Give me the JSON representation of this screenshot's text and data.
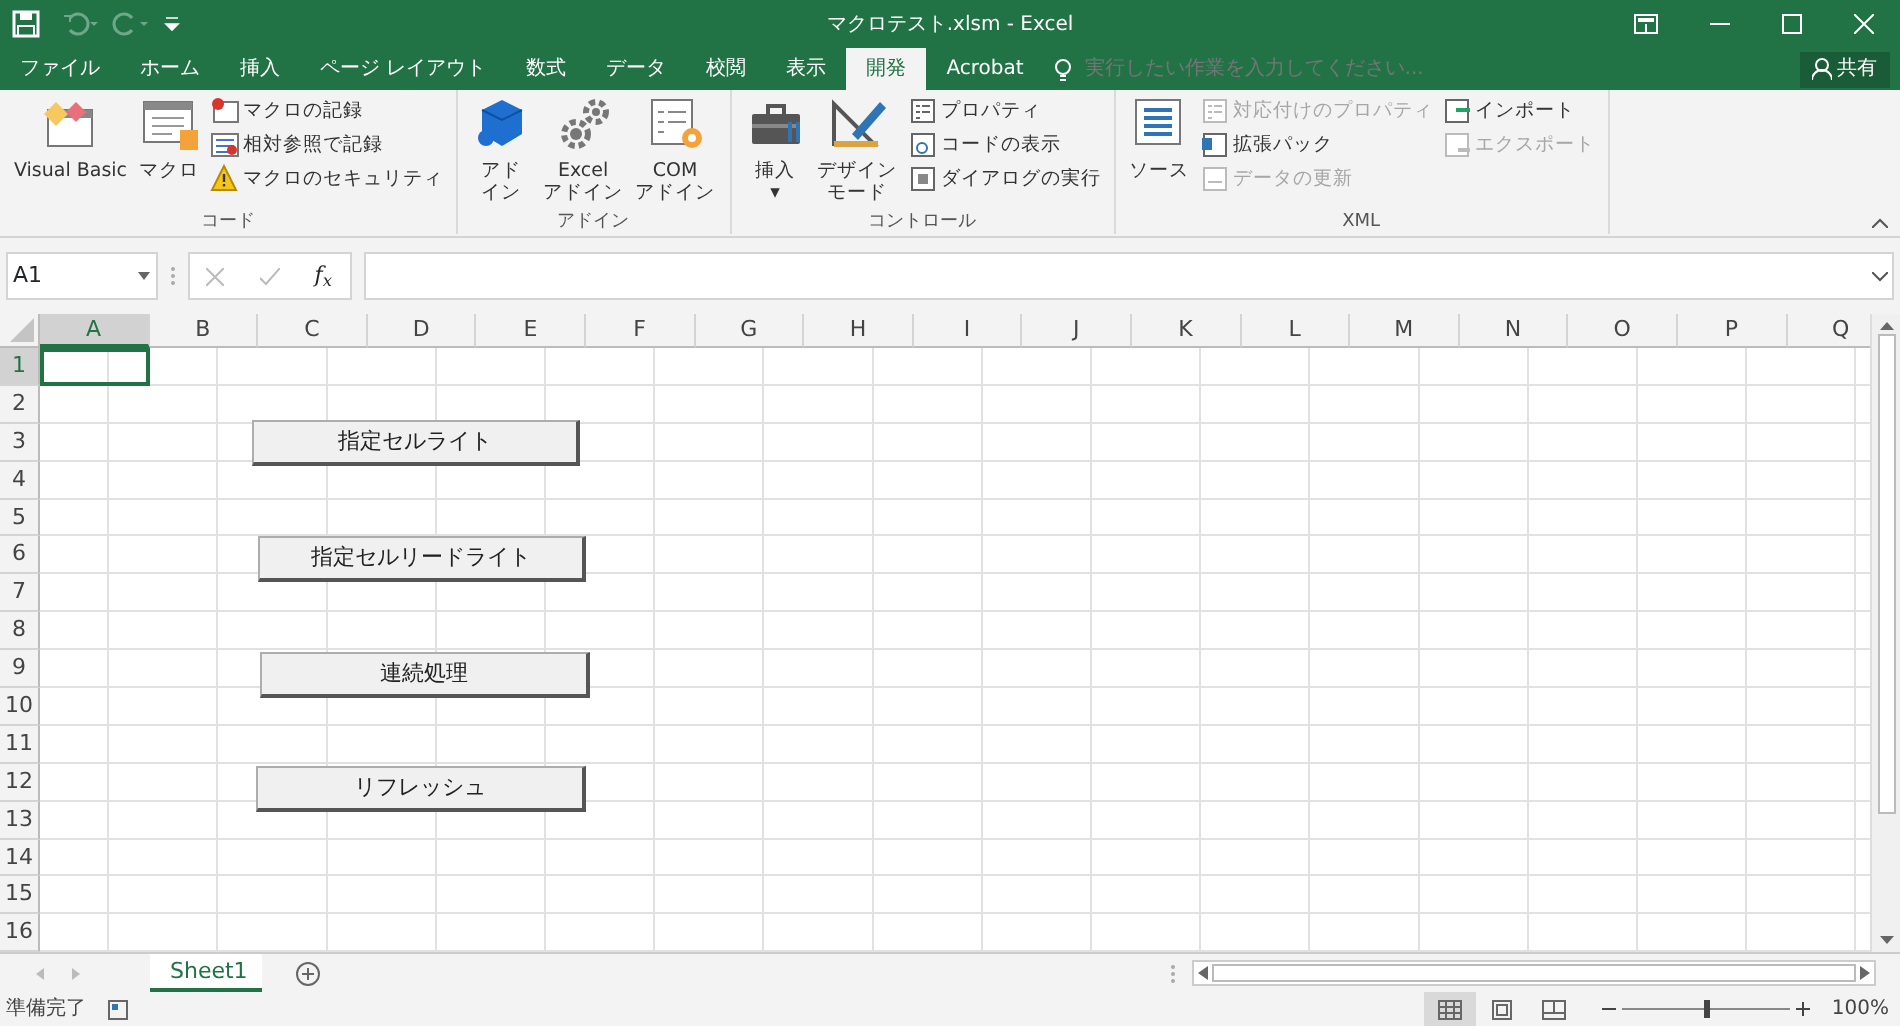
{
  "window": {
    "title": "マクロテスト.xlsm - Excel"
  },
  "ribbon_tabs": [
    {
      "label": "ファイル",
      "selected": false
    },
    {
      "label": "ホーム",
      "selected": false
    },
    {
      "label": "挿入",
      "selected": false
    },
    {
      "label": "ページ レイアウト",
      "selected": false
    },
    {
      "label": "数式",
      "selected": false
    },
    {
      "label": "データ",
      "selected": false
    },
    {
      "label": "校閲",
      "selected": false
    },
    {
      "label": "表示",
      "selected": false
    },
    {
      "label": "開発",
      "selected": true
    },
    {
      "label": "Acrobat",
      "selected": false
    }
  ],
  "tell_me": {
    "placeholder": "実行したい作業を入力してください..."
  },
  "share": "共有",
  "ribbon_groups": [
    {
      "label": "コード",
      "items": [
        {
          "kind": "large",
          "lines": [
            "Visual Basic"
          ],
          "disabled": false
        },
        {
          "kind": "large",
          "lines": [
            "マクロ"
          ],
          "disabled": false
        },
        {
          "kind": "small",
          "lines": [
            "マクロの記録"
          ],
          "disabled": false
        },
        {
          "kind": "small",
          "lines": [
            "相対参照で記録"
          ],
          "disabled": false
        },
        {
          "kind": "small",
          "lines": [
            "マクロのセキュリティ"
          ],
          "disabled": false
        }
      ]
    },
    {
      "label": "アドイン",
      "items": [
        {
          "kind": "large",
          "lines": [
            "アド",
            "イン"
          ],
          "disabled": false
        },
        {
          "kind": "large",
          "lines": [
            "Excel",
            "アドイン"
          ],
          "disabled": false
        },
        {
          "kind": "large",
          "lines": [
            "COM",
            "アドイン"
          ],
          "disabled": false
        }
      ]
    },
    {
      "label": "コントロール",
      "items": [
        {
          "kind": "large",
          "lines": [
            "挿入",
            "▾"
          ],
          "disabled": false
        },
        {
          "kind": "large",
          "lines": [
            "デザイン",
            "モード"
          ],
          "disabled": false
        },
        {
          "kind": "small",
          "lines": [
            "プロパティ"
          ],
          "disabled": false
        },
        {
          "kind": "small",
          "lines": [
            "コードの表示"
          ],
          "disabled": false
        },
        {
          "kind": "small",
          "lines": [
            "ダイアログの実行"
          ],
          "disabled": false
        }
      ]
    },
    {
      "label": "XML",
      "items": [
        {
          "kind": "large",
          "lines": [
            "ソース"
          ],
          "disabled": false
        },
        {
          "kind": "small",
          "lines": [
            "対応付けのプロパティ"
          ],
          "disabled": true
        },
        {
          "kind": "small",
          "lines": [
            "拡張パック"
          ],
          "disabled": false
        },
        {
          "kind": "small",
          "lines": [
            "データの更新"
          ],
          "disabled": true
        },
        {
          "kind": "small",
          "lines": [
            "インポート"
          ],
          "disabled": false
        },
        {
          "kind": "small",
          "lines": [
            "エクスポート"
          ],
          "disabled": true
        }
      ]
    }
  ],
  "name_box": "A1",
  "function_label": "f$_{x}$",
  "columns": [
    {
      "label": "A",
      "selected": true
    },
    {
      "label": "B",
      "selected": false
    },
    {
      "label": "C",
      "selected": false
    },
    {
      "label": "D",
      "selected": false
    },
    {
      "label": "E",
      "selected": false
    },
    {
      "label": "F",
      "selected": false
    },
    {
      "label": "G",
      "selected": false
    },
    {
      "label": "H",
      "selected": false
    },
    {
      "label": "I",
      "selected": false
    },
    {
      "label": "J",
      "selected": false
    },
    {
      "label": "K",
      "selected": false
    },
    {
      "label": "L",
      "selected": false
    },
    {
      "label": "M",
      "selected": false
    },
    {
      "label": "N",
      "selected": false
    },
    {
      "label": "O",
      "selected": false
    },
    {
      "label": "P",
      "selected": false
    },
    {
      "label": "Q",
      "selected": false
    }
  ],
  "rows": [
    {
      "label": "1",
      "selected": true
    },
    {
      "label": "2",
      "selected": false
    },
    {
      "label": "3",
      "selected": false
    },
    {
      "label": "4",
      "selected": false
    },
    {
      "label": "5",
      "selected": false
    },
    {
      "label": "6",
      "selected": false
    },
    {
      "label": "7",
      "selected": false
    },
    {
      "label": "8",
      "selected": false
    },
    {
      "label": "9",
      "selected": false
    },
    {
      "label": "10",
      "selected": false
    },
    {
      "label": "11",
      "selected": false
    },
    {
      "label": "12",
      "selected": false
    },
    {
      "label": "13",
      "selected": false
    },
    {
      "label": "14",
      "selected": false
    },
    {
      "label": "15",
      "selected": false
    },
    {
      "label": "16",
      "selected": false
    }
  ],
  "form_buttons": [
    "指定セルライト",
    "指定セルリードライト",
    "連続処理",
    "リフレッシュ"
  ],
  "sheet_tabs": [
    {
      "label": "Sheet1",
      "selected": true
    }
  ],
  "status_bar": {
    "text": "準備完了",
    "views": [
      {
        "kind": "normal",
        "selected": true
      },
      {
        "kind": "layout",
        "selected": false
      },
      {
        "kind": "pagebreak",
        "selected": false
      }
    ],
    "zoom": {
      "level": 0.5
    },
    "zoom_text": "100%"
  }
}
